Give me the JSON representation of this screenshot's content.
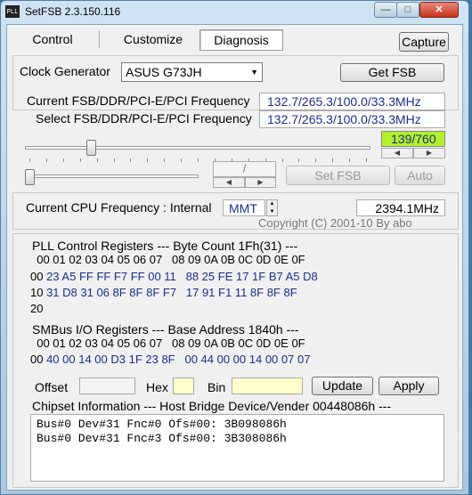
{
  "window": {
    "title": "SetFSB 2.3.150.116",
    "app_icon_text": "PLL"
  },
  "tabs": [
    {
      "label": "Control"
    },
    {
      "label": "Customize"
    },
    {
      "label": "Diagnosis"
    }
  ],
  "capture_label": "Capture",
  "clock": {
    "label": "Clock Generator",
    "selected": "ASUS G73JH",
    "get_fsb_label": "Get FSB",
    "current_label": "Current FSB/DDR/PCI-E/PCI Frequency",
    "current_value": "132.7/265.3/100.0/33.3MHz",
    "select_label": "Select FSB/DDR/PCI-E/PCI Frequency",
    "select_value": "132.7/265.3/100.0/33.3MHz",
    "slider_readout": "139/760",
    "slider_level": 0.183,
    "ratio_separator": "/",
    "set_fsb_label": "Set FSB",
    "auto_label": "Auto"
  },
  "cpu": {
    "label": "Current CPU Frequency : Internal",
    "source": "MMT",
    "value": "2394.1MHz",
    "copyright": "Copyright (C) 2001-10 By abo"
  },
  "pll": {
    "title": "PLL Control Registers  --- Byte Count 1Fh(31) ---",
    "header": "  00 01 02 03 04 05 06 07   08 09 0A 0B 0C 0D 0E 0F",
    "rows": [
      {
        "addr": "00",
        "data": " 23 A5 FF FF F7 FF 00 11   88 25 FE 17 1F B7 A5 D8"
      },
      {
        "addr": "10",
        "data": " 31 D8 31 06 8F 8F 8F F7   17 91 F1 11 8F 8F 8F"
      },
      {
        "addr": "20",
        "data": ""
      }
    ]
  },
  "smbus": {
    "title": "SMBus I/O Registers  --- Base Address 1840h ---",
    "header": "  00 01 02 03 04 05 06 07   08 09 0A 0B 0C 0D 0E 0F",
    "rows": [
      {
        "addr": "00",
        "data": " 40 00 14 00 D3 1F 23 8F   00 44 00 00 14 00 07 07"
      }
    ]
  },
  "fields": {
    "offset_label": "Offset",
    "hex_label": "Hex",
    "bin_label": "Bin",
    "update_label": "Update",
    "apply_label": "Apply"
  },
  "chipset": {
    "title": "Chipset Information  --- Host Bridge Device/Vender 00448086h ---",
    "lines": [
      "Bus#0 Dev#31 Fnc#0 Ofs#00: 3B098086h",
      "Bus#0 Dev#31 Fnc#3 Ofs#00: 3B308086h"
    ]
  },
  "colors": {
    "readout_bg": "#b2f02a",
    "value_text": "#1c2e8c",
    "hex_field_bg": "#ffffcc"
  },
  "icons": {
    "minimize": "minimize-icon",
    "maximize": "maximize-icon",
    "close": "close-icon"
  }
}
